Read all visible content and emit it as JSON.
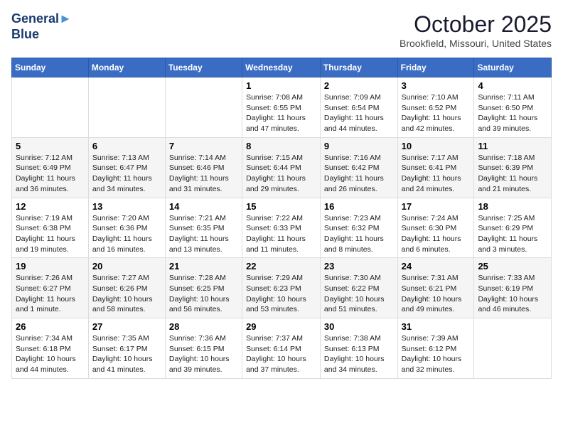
{
  "header": {
    "logo_line1": "General",
    "logo_line2": "Blue",
    "month_title": "October 2025",
    "location": "Brookfield, Missouri, United States"
  },
  "weekdays": [
    "Sunday",
    "Monday",
    "Tuesday",
    "Wednesday",
    "Thursday",
    "Friday",
    "Saturday"
  ],
  "weeks": [
    [
      {
        "day": "",
        "info": ""
      },
      {
        "day": "",
        "info": ""
      },
      {
        "day": "",
        "info": ""
      },
      {
        "day": "1",
        "info": "Sunrise: 7:08 AM\nSunset: 6:55 PM\nDaylight: 11 hours and 47 minutes."
      },
      {
        "day": "2",
        "info": "Sunrise: 7:09 AM\nSunset: 6:54 PM\nDaylight: 11 hours and 44 minutes."
      },
      {
        "day": "3",
        "info": "Sunrise: 7:10 AM\nSunset: 6:52 PM\nDaylight: 11 hours and 42 minutes."
      },
      {
        "day": "4",
        "info": "Sunrise: 7:11 AM\nSunset: 6:50 PM\nDaylight: 11 hours and 39 minutes."
      }
    ],
    [
      {
        "day": "5",
        "info": "Sunrise: 7:12 AM\nSunset: 6:49 PM\nDaylight: 11 hours and 36 minutes."
      },
      {
        "day": "6",
        "info": "Sunrise: 7:13 AM\nSunset: 6:47 PM\nDaylight: 11 hours and 34 minutes."
      },
      {
        "day": "7",
        "info": "Sunrise: 7:14 AM\nSunset: 6:46 PM\nDaylight: 11 hours and 31 minutes."
      },
      {
        "day": "8",
        "info": "Sunrise: 7:15 AM\nSunset: 6:44 PM\nDaylight: 11 hours and 29 minutes."
      },
      {
        "day": "9",
        "info": "Sunrise: 7:16 AM\nSunset: 6:42 PM\nDaylight: 11 hours and 26 minutes."
      },
      {
        "day": "10",
        "info": "Sunrise: 7:17 AM\nSunset: 6:41 PM\nDaylight: 11 hours and 24 minutes."
      },
      {
        "day": "11",
        "info": "Sunrise: 7:18 AM\nSunset: 6:39 PM\nDaylight: 11 hours and 21 minutes."
      }
    ],
    [
      {
        "day": "12",
        "info": "Sunrise: 7:19 AM\nSunset: 6:38 PM\nDaylight: 11 hours and 19 minutes."
      },
      {
        "day": "13",
        "info": "Sunrise: 7:20 AM\nSunset: 6:36 PM\nDaylight: 11 hours and 16 minutes."
      },
      {
        "day": "14",
        "info": "Sunrise: 7:21 AM\nSunset: 6:35 PM\nDaylight: 11 hours and 13 minutes."
      },
      {
        "day": "15",
        "info": "Sunrise: 7:22 AM\nSunset: 6:33 PM\nDaylight: 11 hours and 11 minutes."
      },
      {
        "day": "16",
        "info": "Sunrise: 7:23 AM\nSunset: 6:32 PM\nDaylight: 11 hours and 8 minutes."
      },
      {
        "day": "17",
        "info": "Sunrise: 7:24 AM\nSunset: 6:30 PM\nDaylight: 11 hours and 6 minutes."
      },
      {
        "day": "18",
        "info": "Sunrise: 7:25 AM\nSunset: 6:29 PM\nDaylight: 11 hours and 3 minutes."
      }
    ],
    [
      {
        "day": "19",
        "info": "Sunrise: 7:26 AM\nSunset: 6:27 PM\nDaylight: 11 hours and 1 minute."
      },
      {
        "day": "20",
        "info": "Sunrise: 7:27 AM\nSunset: 6:26 PM\nDaylight: 10 hours and 58 minutes."
      },
      {
        "day": "21",
        "info": "Sunrise: 7:28 AM\nSunset: 6:25 PM\nDaylight: 10 hours and 56 minutes."
      },
      {
        "day": "22",
        "info": "Sunrise: 7:29 AM\nSunset: 6:23 PM\nDaylight: 10 hours and 53 minutes."
      },
      {
        "day": "23",
        "info": "Sunrise: 7:30 AM\nSunset: 6:22 PM\nDaylight: 10 hours and 51 minutes."
      },
      {
        "day": "24",
        "info": "Sunrise: 7:31 AM\nSunset: 6:21 PM\nDaylight: 10 hours and 49 minutes."
      },
      {
        "day": "25",
        "info": "Sunrise: 7:33 AM\nSunset: 6:19 PM\nDaylight: 10 hours and 46 minutes."
      }
    ],
    [
      {
        "day": "26",
        "info": "Sunrise: 7:34 AM\nSunset: 6:18 PM\nDaylight: 10 hours and 44 minutes."
      },
      {
        "day": "27",
        "info": "Sunrise: 7:35 AM\nSunset: 6:17 PM\nDaylight: 10 hours and 41 minutes."
      },
      {
        "day": "28",
        "info": "Sunrise: 7:36 AM\nSunset: 6:15 PM\nDaylight: 10 hours and 39 minutes."
      },
      {
        "day": "29",
        "info": "Sunrise: 7:37 AM\nSunset: 6:14 PM\nDaylight: 10 hours and 37 minutes."
      },
      {
        "day": "30",
        "info": "Sunrise: 7:38 AM\nSunset: 6:13 PM\nDaylight: 10 hours and 34 minutes."
      },
      {
        "day": "31",
        "info": "Sunrise: 7:39 AM\nSunset: 6:12 PM\nDaylight: 10 hours and 32 minutes."
      },
      {
        "day": "",
        "info": ""
      }
    ]
  ]
}
